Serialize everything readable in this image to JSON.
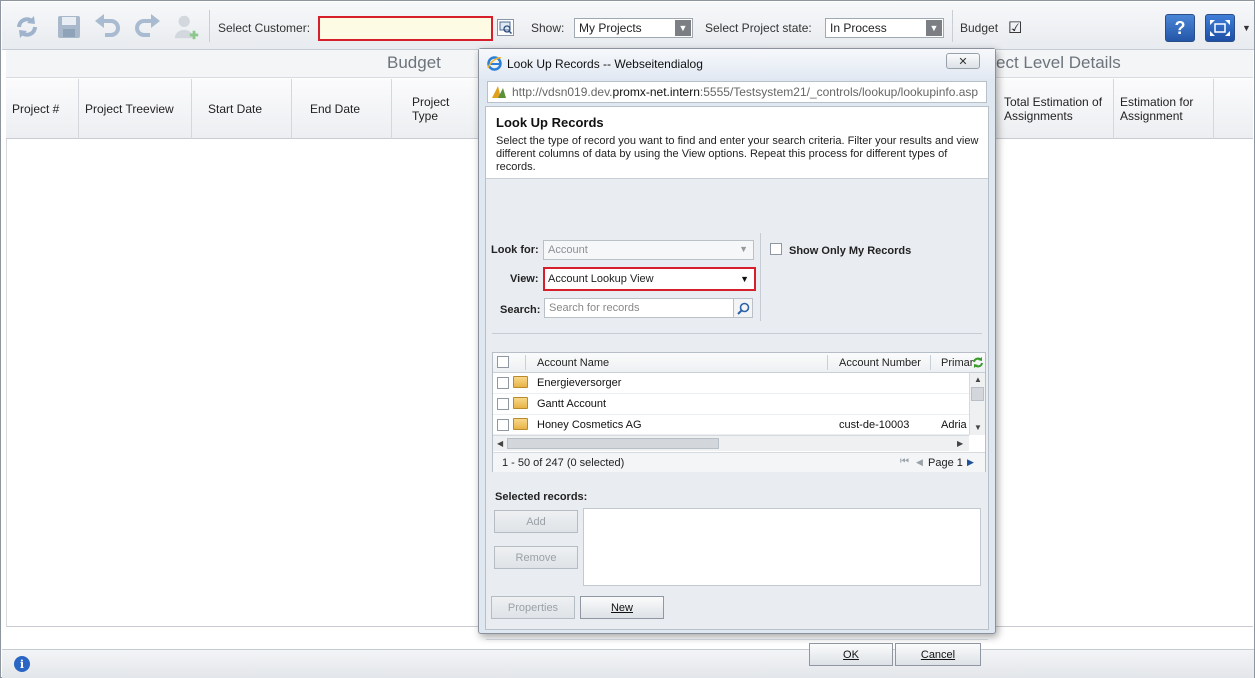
{
  "toolbar": {
    "select_customer_label": "Select Customer:",
    "show_label": "Show:",
    "show_value": "My Projects",
    "project_state_label": "Select Project state:",
    "project_state_value": "In Process",
    "budget_label": "Budget",
    "budget_checked": true,
    "help_label": "?"
  },
  "sections": {
    "budget": "Budget",
    "project_level_details": "ect Level Details"
  },
  "columns": [
    "Project #",
    "Project Treeview",
    "Start Date",
    "End Date",
    "Project Type",
    "Total Estimation of Assignments",
    "Estimation for Assignment"
  ],
  "dialog": {
    "title": "Look Up Records -- Webseitendialog",
    "close_label": "✕",
    "url_prefix": "http://vdsn019.dev.",
    "url_host": "promx-net.intern",
    "url_suffix": ":5555/Testsystem21/_controls/lookup/lookupinfo.asp",
    "heading": "Look Up Records",
    "description": "Select the type of record you want to find and enter your search criteria. Filter your results and view different columns of data by using the View options. Repeat this process for different types of records.",
    "look_for_label": "Look for:",
    "look_for_value": "Account",
    "view_label": "View:",
    "view_value": "Account Lookup View",
    "search_label": "Search:",
    "search_placeholder": "Search for records",
    "show_only_mine_label": "Show Only My Records",
    "grid": {
      "headers": [
        "Account Name",
        "Account Number",
        "Primar"
      ],
      "rows": [
        {
          "name": "Energieversorger",
          "number": "",
          "primary": ""
        },
        {
          "name": "Gantt Account",
          "number": "",
          "primary": ""
        },
        {
          "name": "Honey Cosmetics AG",
          "number": "cust-de-10003",
          "primary": "Adria"
        }
      ],
      "paging_text": "1 - 50 of 247 (0 selected)",
      "page_label": "Page 1"
    },
    "selected_records_label": "Selected records:",
    "add_label": "Add",
    "remove_label": "Remove",
    "properties_label": "Properties",
    "new_label": "New",
    "ok_label": "OK",
    "cancel_label": "Cancel"
  },
  "colors": {
    "highlight_red": "#d61f2b",
    "customer_field_bg": "#fdfbe4",
    "help_blue": "#2456a8"
  }
}
